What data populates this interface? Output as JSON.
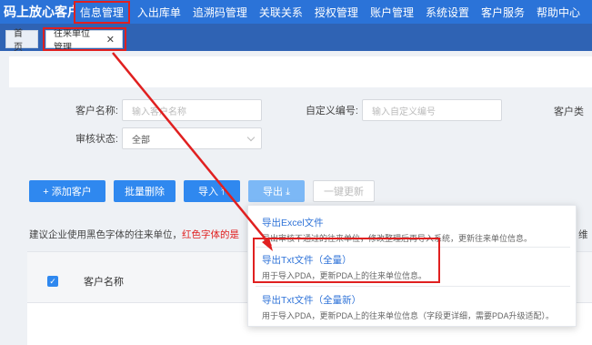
{
  "app": {
    "title": "码上放心客户端"
  },
  "nav": [
    "信息管理",
    "入出库单",
    "追溯码管理",
    "关联关系",
    "授权管理",
    "账户管理",
    "系统设置",
    "客户服务",
    "帮助中心"
  ],
  "tabs": {
    "home": "首页",
    "active": "往来单位管理",
    "close": "✕"
  },
  "form": {
    "customer_name_label": "客户名称:",
    "customer_name_placeholder": "输入客户名称",
    "custom_code_label": "自定义编号:",
    "custom_code_placeholder": "输入自定义编号",
    "customer_type_label": "客户类",
    "review_status_label": "审核状态:",
    "review_status_value": "全部"
  },
  "toolbar": {
    "add": "+ 添加客户",
    "batch_delete": "批量删除",
    "import": "导入 ⤒",
    "export": "导出 ⤓",
    "one_click_update": "一键更新"
  },
  "notice": {
    "prefix": "建议企业使用黑色字体的往来单位，",
    "red": "红色字体的是",
    "tail": "维"
  },
  "table": {
    "checkbox": "✓",
    "col_customer_name": "客户名称"
  },
  "export_menu": [
    {
      "title": "导出Excel文件",
      "desc": "导出审核不通过的往来单位，修改整理后再导入系统，更新往来单位信息。"
    },
    {
      "title": "导出Txt文件（全量）",
      "desc": "用于导入PDA，更新PDA上的往来单位信息。"
    },
    {
      "title": "导出Txt文件（全量新）",
      "desc": "用于导入PDA，更新PDA上的往来单位信息（字段更详细，需要PDA升级适配）。"
    }
  ],
  "colors": {
    "primary": "#2f88ef",
    "nav": "#2b73d8",
    "highlight": "#e02020"
  }
}
